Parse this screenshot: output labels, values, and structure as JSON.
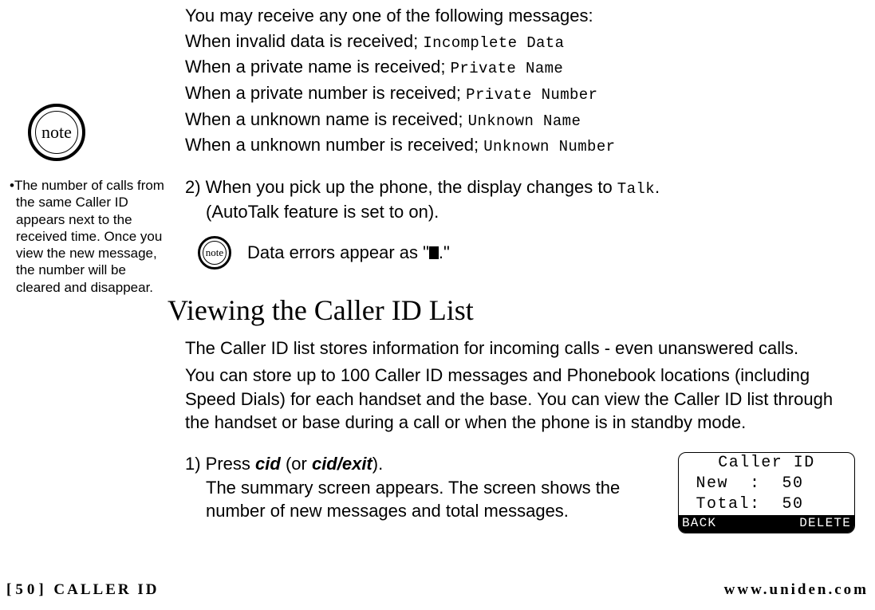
{
  "marginNote": {
    "badgeLabel": "note",
    "text": "•The number of calls from the same Caller ID appears next to the received time. Once you view the new message, the number will be cleared and disappear."
  },
  "intro": {
    "l1": "You may receive any one of the following messages:",
    "l2a": "When invalid data is received; ",
    "l2b": "Incomplete Data",
    "l3a": "When a private name is received; ",
    "l3b": "Private Name",
    "l4a": "When a private number is received; ",
    "l4b": "Private Number",
    "l5a": "When a unknown name is received; ",
    "l5b": "Unknown Name",
    "l6a": "When a unknown number is received; ",
    "l6b": "Unknown Number"
  },
  "stepA": {
    "lineA1a": "2) When you pick up the phone, the display changes to ",
    "lineA1b": "Talk",
    "lineA1c": ".",
    "lineA2": "(AutoTalk feature is set to on)."
  },
  "inlineNote": {
    "iconLabel": "note",
    "textA": "Data errors appear as \"",
    "textB": ".\""
  },
  "heading": "Viewing the Caller ID List",
  "para": {
    "p1": "The Caller ID list stores information for incoming calls - even unanswered calls.",
    "p2": "You can store up to 100 Caller ID messages and Phonebook locations (including Speed Dials) for each handset and the base. You can view the Caller ID list through the handset or base during a call or when the phone is in standby mode."
  },
  "stepB": {
    "t1a": "1) Press ",
    "t1b": "cid",
    "t1c": " (or ",
    "t1d": "cid/exit",
    "t1e": ").",
    "t2": "The summary screen appears. The screen shows the number of new messages and total messages."
  },
  "display": {
    "line1": "Caller ID",
    "line2": " New  :  50",
    "line3": " Total:  50",
    "back": " BACK",
    "delete": "DELETE"
  },
  "footer": {
    "leftBracket": "[50]",
    "leftText": " CALLER ID",
    "right": "www.uniden.com"
  }
}
